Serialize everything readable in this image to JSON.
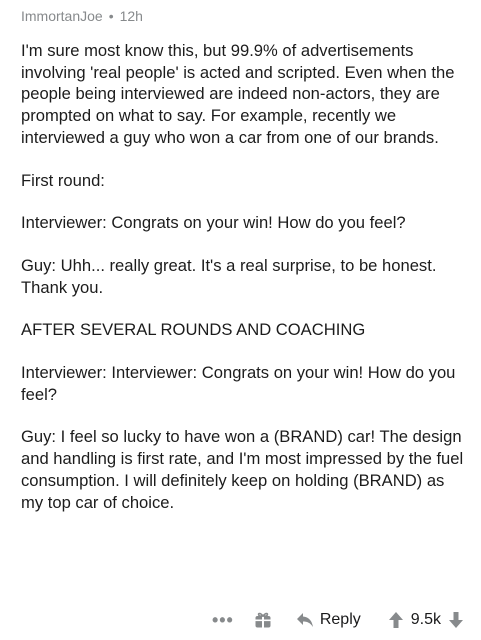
{
  "comment": {
    "author": "ImmortanJoe",
    "separator": "•",
    "age": "12h",
    "paragraphs": [
      "I'm sure most know this, but 99.9% of advertisements involving 'real people' is acted and scripted. Even when the people being interviewed are indeed non-actors, they are prompted on what to say. For example, recently we interviewed a guy who won a car from one of our brands.",
      "First round:",
      "Interviewer: Congrats on your win! How do you feel?",
      "Guy: Uhh... really great. It's a real surprise, to be honest. Thank you.",
      "AFTER SEVERAL ROUNDS AND COACHING",
      "Interviewer: Interviewer: Congrats on your win! How do you feel?",
      "Guy: I feel so lucky to have won a (BRAND) car! The design and handling is first rate, and I'm most impressed by the fuel consumption. I will definitely keep on holding (BRAND) as my top car of choice."
    ]
  },
  "actions": {
    "more_label": "•••",
    "more_icon": "ellipsis-icon",
    "award_icon": "gift-icon",
    "reply_icon": "reply-arrow-icon",
    "reply_label": "Reply",
    "upvote_icon": "upvote-arrow-icon",
    "score": "9.5k",
    "downvote_icon": "downvote-arrow-icon"
  },
  "colors": {
    "meta_text": "#878a8c",
    "body_text": "#1c1c1c",
    "background": "#ffffff"
  }
}
